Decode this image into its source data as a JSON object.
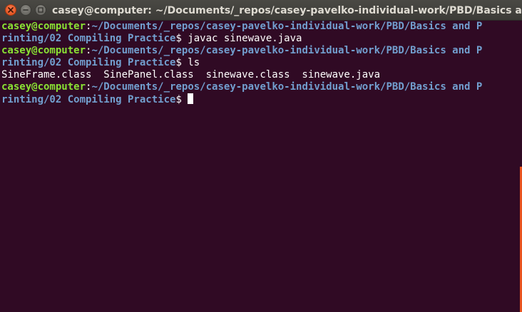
{
  "window": {
    "title": "casey@computer: ~/Documents/_repos/casey-pavelko-individual-work/PBD/Basics and Pri",
    "buttons": [
      {
        "name": "close",
        "icon": "close-icon"
      },
      {
        "name": "minimize",
        "icon": "minimize-icon"
      },
      {
        "name": "maximize",
        "icon": "maximize-icon"
      }
    ]
  },
  "terminal": {
    "lines": [
      {
        "user": "casey@computer",
        "sep": ":",
        "path": "~/Documents/_repos/casey-pavelko-individual-work/PBD/Basics and P"
      },
      {
        "path": "rinting/02 Compiling Practice",
        "prompt": "$ ",
        "command": "javac sinewave.java"
      },
      {
        "user": "casey@computer",
        "sep": ":",
        "path": "~/Documents/_repos/casey-pavelko-individual-work/PBD/Basics and P"
      },
      {
        "path": "rinting/02 Compiling Practice",
        "prompt": "$ ",
        "command": "ls"
      },
      {
        "output": "SineFrame.class  SinePanel.class  sinewave.class  sinewave.java"
      },
      {
        "user": "casey@computer",
        "sep": ":",
        "path": "~/Documents/_repos/casey-pavelko-individual-work/PBD/Basics and P"
      },
      {
        "path": "rinting/02 Compiling Practice",
        "prompt": "$"
      }
    ]
  },
  "colors": {
    "background": "#300a24",
    "user": "#8ae234",
    "path": "#729fcf",
    "text": "#ffffff",
    "close_button": "#df4b16",
    "scrollbar": "#e95420"
  }
}
